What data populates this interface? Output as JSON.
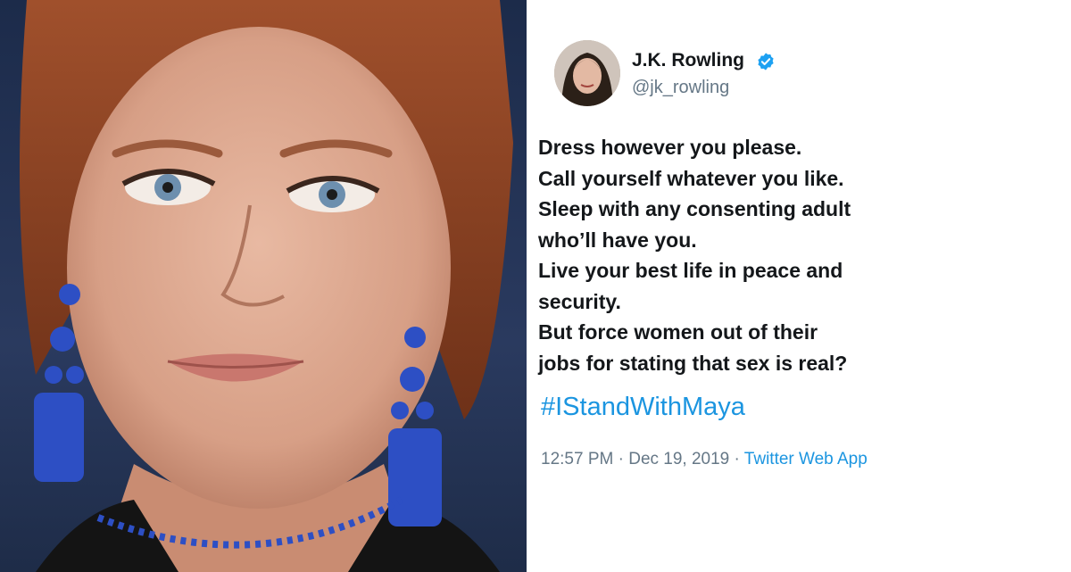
{
  "tweet": {
    "author": {
      "display_name": "J.K. Rowling",
      "handle": "@jk_rowling",
      "verified_icon": "verified-badge-icon"
    },
    "body_lines": [
      "Dress however you please.",
      "Call yourself whatever you like.",
      "Sleep with any consenting adult",
      "who’ll have you.",
      "Live your best life in peace and",
      "security.",
      "But force women out of their",
      "jobs for stating that sex is real?"
    ],
    "hashtag": "#IStandWithMaya",
    "time": "12:57 PM",
    "separator": "·",
    "date": "Dec 19, 2019",
    "source": "Twitter Web App"
  },
  "colors": {
    "link": "#1b95e0",
    "text": "#14171a",
    "muted": "#657786",
    "backdrop": "#1c2b4a",
    "earring_blue": "#2d4fc4"
  }
}
